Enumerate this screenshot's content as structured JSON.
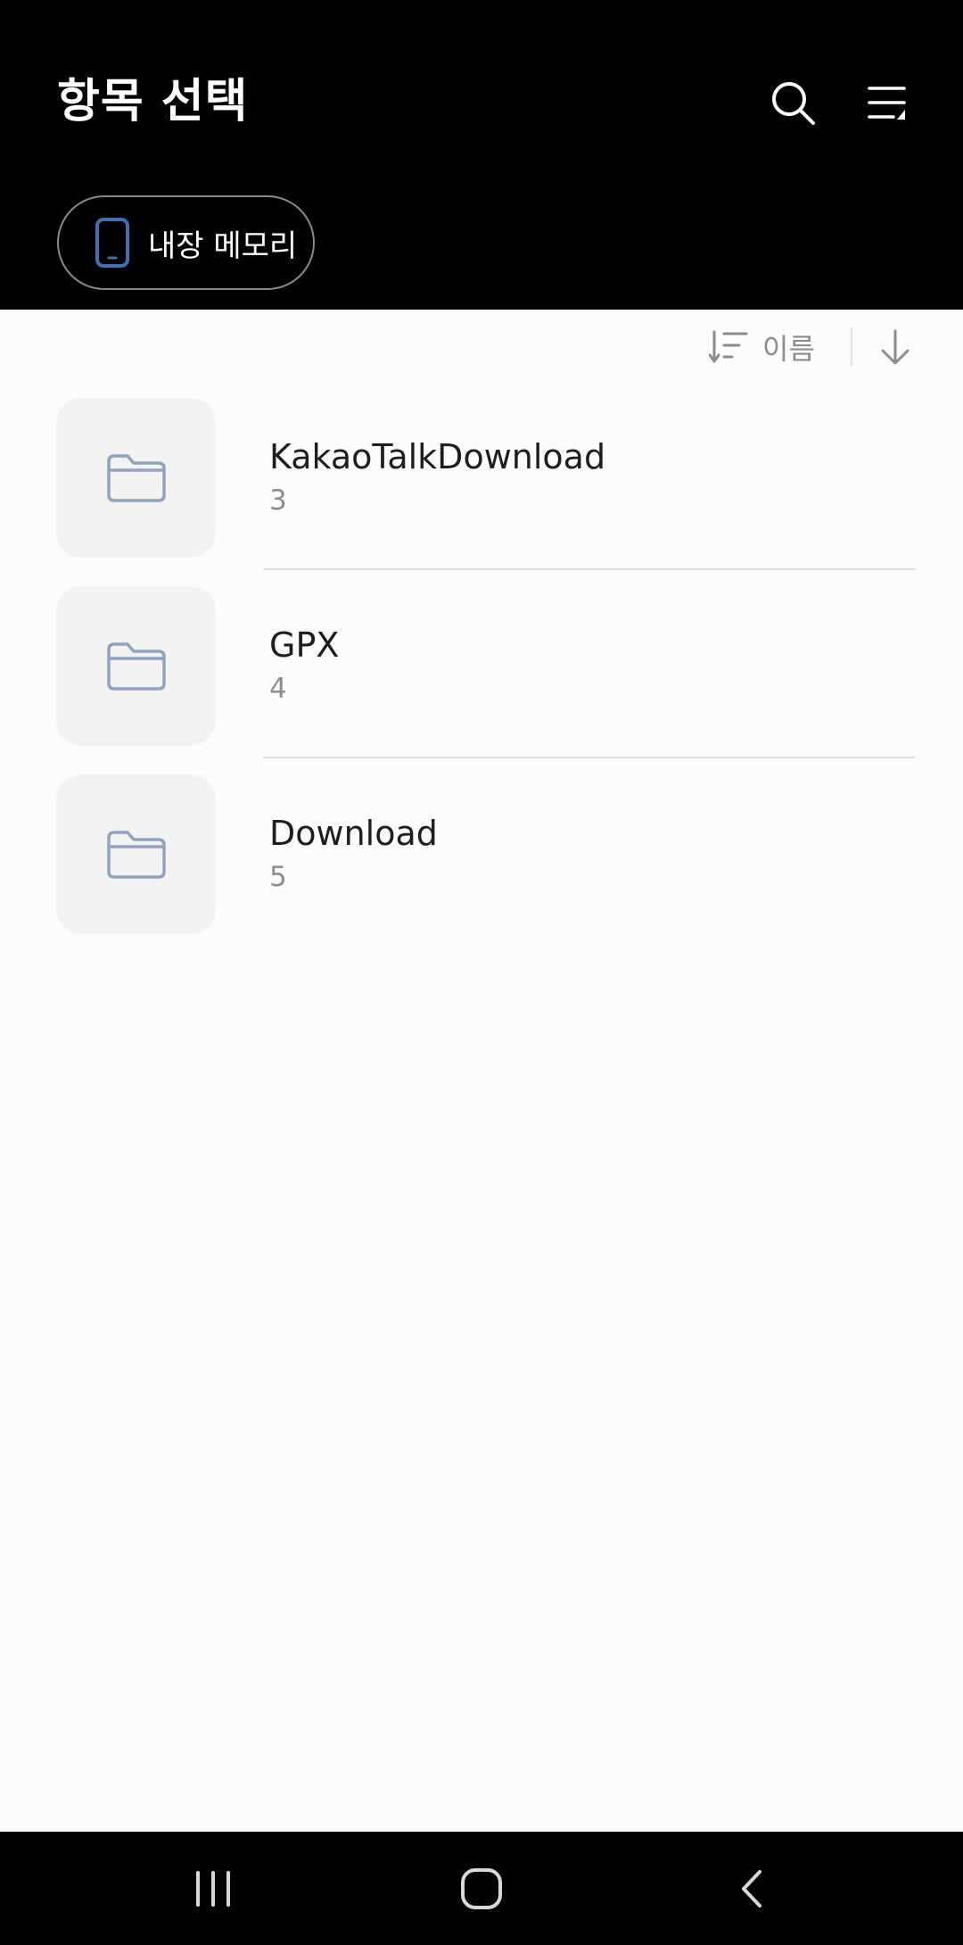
{
  "header": {
    "title": "항목 선택",
    "search_icon": "search-icon",
    "menu_icon": "list-menu-icon"
  },
  "storage": {
    "label": "내장 메모리",
    "icon": "phone-icon",
    "accent_color": "#3f6fb5"
  },
  "sort": {
    "label": "이름",
    "sort_icon": "sort-icon",
    "order_icon": "arrow-down-icon"
  },
  "folders": [
    {
      "name": "KakaoTalkDownload",
      "count": "3",
      "icon": "folder-icon"
    },
    {
      "name": "GPX",
      "count": "4",
      "icon": "folder-icon"
    },
    {
      "name": "Download",
      "count": "5",
      "icon": "folder-icon"
    }
  ],
  "navbar": {
    "recents_icon": "recents-icon",
    "home_icon": "home-icon",
    "back_icon": "back-icon"
  },
  "colors": {
    "header_bg": "#000000",
    "page_bg": "#fcfcfc",
    "folder_icon": "#8fa4c2"
  }
}
